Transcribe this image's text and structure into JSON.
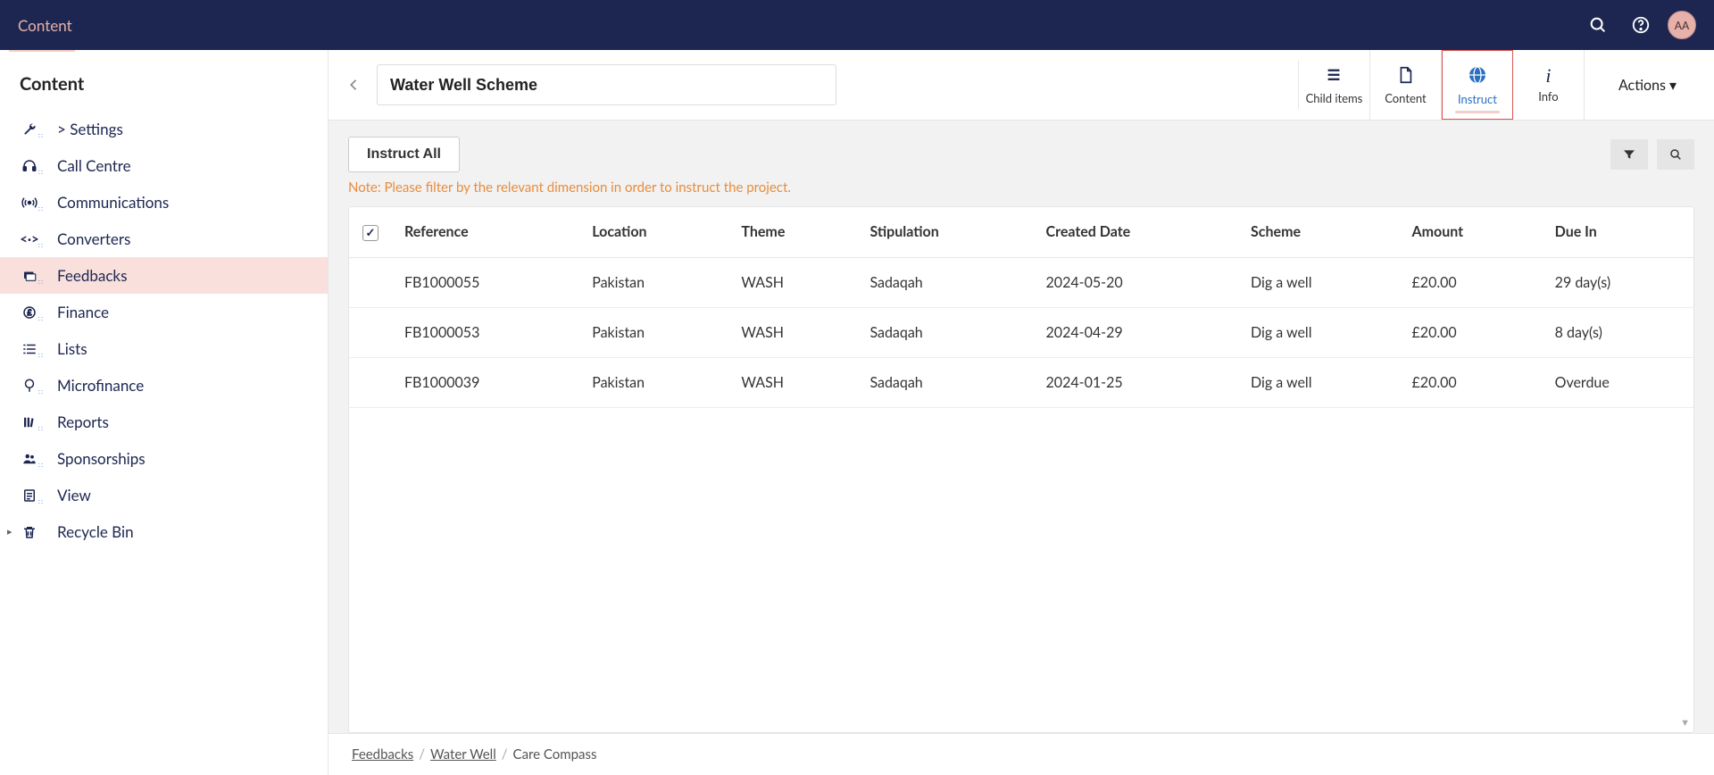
{
  "topbar": {
    "brand": "Content",
    "avatar": "AA"
  },
  "sidebar": {
    "title": "Content",
    "items": [
      {
        "label": "> Settings",
        "icon": "wrench"
      },
      {
        "label": "Call Centre",
        "icon": "headset"
      },
      {
        "label": "Communications",
        "icon": "broadcast"
      },
      {
        "label": "Converters",
        "icon": "code"
      },
      {
        "label": "Feedbacks",
        "icon": "layers",
        "active": true
      },
      {
        "label": "Finance",
        "icon": "coin"
      },
      {
        "label": "Lists",
        "icon": "list"
      },
      {
        "label": "Microfinance",
        "icon": "globe-pin"
      },
      {
        "label": "Reports",
        "icon": "books"
      },
      {
        "label": "Sponsorships",
        "icon": "people"
      },
      {
        "label": "View",
        "icon": "doc"
      },
      {
        "label": "Recycle Bin",
        "icon": "trash",
        "caret": true
      }
    ]
  },
  "header": {
    "title_value": "Water Well Scheme",
    "tabs": [
      {
        "label": "Child items",
        "icon": "tree"
      },
      {
        "label": "Content",
        "icon": "page"
      },
      {
        "label": "Instruct",
        "icon": "globe",
        "active": true
      },
      {
        "label": "Info",
        "icon": "info-i"
      }
    ],
    "actions_label": "Actions"
  },
  "toolbar": {
    "instruct_all": "Instruct All",
    "note": "Note: Please filter by the relevant dimension in order to instruct the project."
  },
  "table": {
    "columns": [
      "Reference",
      "Location",
      "Theme",
      "Stipulation",
      "Created Date",
      "Scheme",
      "Amount",
      "Due In"
    ],
    "rows": [
      {
        "reference": "FB1000055",
        "location": "Pakistan",
        "theme": "WASH",
        "stipulation": "Sadaqah",
        "created": "2024-05-20",
        "scheme": "Dig a well",
        "amount": "£20.00",
        "due": "29 day(s)"
      },
      {
        "reference": "FB1000053",
        "location": "Pakistan",
        "theme": "WASH",
        "stipulation": "Sadaqah",
        "created": "2024-04-29",
        "scheme": "Dig a well",
        "amount": "£20.00",
        "due": "8 day(s)"
      },
      {
        "reference": "FB1000039",
        "location": "Pakistan",
        "theme": "WASH",
        "stipulation": "Sadaqah",
        "created": "2024-01-25",
        "scheme": "Dig a well",
        "amount": "£20.00",
        "due": "Overdue"
      }
    ]
  },
  "breadcrumb": {
    "items": [
      "Feedbacks",
      "Water Well",
      "Care Compass"
    ]
  }
}
